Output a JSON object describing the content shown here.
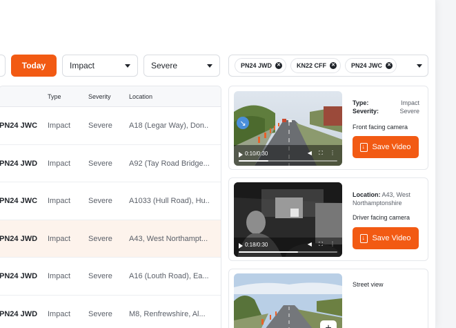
{
  "filters": {
    "today_label": "Today",
    "type_select": "Impact",
    "severity_select": "Severe",
    "vehicle_chips": [
      "PN24 JWD",
      "KN22 CFF",
      "PN24 JWC"
    ]
  },
  "table": {
    "headers": {
      "type": "Type",
      "severity": "Severity",
      "location": "Location"
    },
    "rows": [
      {
        "reg": "PN24 JWC",
        "type": "Impact",
        "severity": "Severe",
        "location": "A18 (Legar Way), Don..."
      },
      {
        "reg": "PN24 JWD",
        "type": "Impact",
        "severity": "Severe",
        "location": "A92 (Tay Road Bridge..."
      },
      {
        "reg": "PN24 JWC",
        "type": "Impact",
        "severity": "Severe",
        "location": "A1033 (Hull Road), Hu..."
      },
      {
        "reg": "PN24 JWD",
        "type": "Impact",
        "severity": "Severe",
        "location": "A43, West Northampt..."
      },
      {
        "reg": "PN24 JWD",
        "type": "Impact",
        "severity": "Severe",
        "location": "A16 (Louth Road), Ea..."
      },
      {
        "reg": "PN24 JWD",
        "type": "Impact",
        "severity": "Severe",
        "location": "M8, Renfrewshire, Al..."
      }
    ]
  },
  "detail": {
    "front": {
      "type_label": "Type:",
      "type_value": "Impact",
      "severity_label": "Severity:",
      "severity_value": "Severe",
      "caption": "Front facing camera",
      "save_label": "Save Video",
      "time": "0:10/0:30",
      "progress": 0.3
    },
    "driver": {
      "location_label": "Location:",
      "location_value": "A43, West Northamptonshire",
      "caption": "Driver facing camera",
      "save_label": "Save Video",
      "time": "0:18/0:30",
      "progress": 0.6
    },
    "street": {
      "caption": "Street view",
      "plus_label": "+"
    }
  },
  "colors": {
    "accent": "#f25a13",
    "highlight_row": "#fdf3ec"
  }
}
